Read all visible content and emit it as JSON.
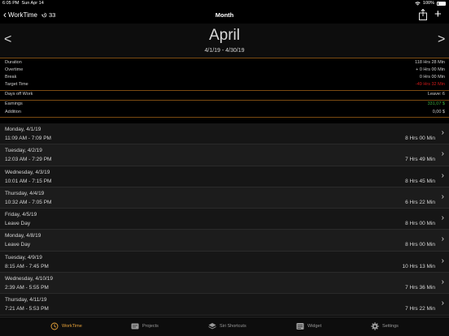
{
  "status": {
    "time": "6:05 PM",
    "date": "Sun Apr 14",
    "battery": "100%"
  },
  "nav": {
    "back_label": "WorkTime",
    "counter": "33",
    "title": "Month"
  },
  "header": {
    "month": "April",
    "range": "4/1/19 - 4/30/19",
    "prev": "<",
    "next": ">"
  },
  "stats": {
    "group1": [
      {
        "label": "Duration",
        "value": "118 Hrs 28 Min"
      },
      {
        "label": "Overtime",
        "value": "+ 0 Hrs 00 Min"
      },
      {
        "label": "Break",
        "value": "0 Hrs 00 Min"
      },
      {
        "label": "Target Time",
        "value": "-49 Hrs 32 Min"
      }
    ],
    "group2": [
      {
        "label": "Days off Work",
        "value": "Leave: 6"
      }
    ],
    "group3": [
      {
        "label": "Earnings",
        "value": "331,07 $"
      },
      {
        "label": "Addition",
        "value": "0,00 $"
      }
    ]
  },
  "entries": [
    {
      "date": "Monday, 4/1/19",
      "time": "11:09 AM - 7:09 PM",
      "duration": "8 Hrs 00 Min"
    },
    {
      "date": "Tuesday, 4/2/19",
      "time": "12:03 AM - 7:29 PM",
      "duration": "7 Hrs 49 Min"
    },
    {
      "date": "Wednesday, 4/3/19",
      "time": "10:01 AM - 7:15 PM",
      "duration": "8 Hrs 45 Min"
    },
    {
      "date": "Thursday, 4/4/19",
      "time": "10:32 AM - 7:05 PM",
      "duration": "6 Hrs 22 Min"
    },
    {
      "date": "Friday, 4/5/19",
      "time": "Leave Day",
      "duration": "8 Hrs 00 Min"
    },
    {
      "date": "Monday, 4/8/19",
      "time": "Leave Day",
      "duration": "8 Hrs 00 Min"
    },
    {
      "date": "Tuesday, 4/9/19",
      "time": "8:15 AM - 7:45 PM",
      "duration": "10 Hrs 13 Min"
    },
    {
      "date": "Wednesday, 4/10/19",
      "time": "2:39 AM - 5:55 PM",
      "duration": "7 Hrs 36 Min"
    },
    {
      "date": "Thursday, 4/11/19",
      "time": "7:21 AM - 5:53 PM",
      "duration": "7 Hrs 22 Min"
    }
  ],
  "tabs": [
    {
      "label": "WorkTime",
      "icon": "clock-icon"
    },
    {
      "label": "Projects",
      "icon": "folder-icon"
    },
    {
      "label": "Siri Shortcuts",
      "icon": "layers-icon"
    },
    {
      "label": "Widget",
      "icon": "widget-icon"
    },
    {
      "label": "Settings",
      "icon": "gear-icon"
    }
  ],
  "colors": {
    "accent": "#e8a33a",
    "negative": "#d31a1a",
    "positive": "#3caa3c",
    "divider": "#7a4a12"
  }
}
